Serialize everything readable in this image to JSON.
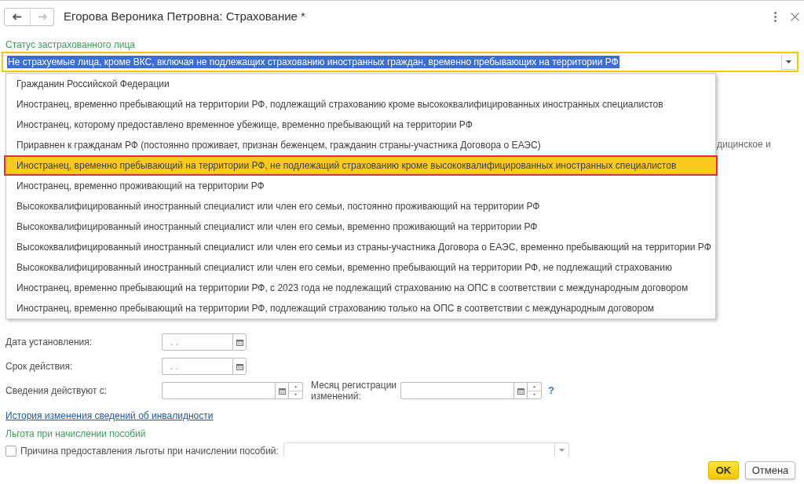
{
  "window": {
    "title": "Егорова Вероника Петровна: Страхование *"
  },
  "nav": [
    {
      "kind": "back",
      "disabled": false
    },
    {
      "kind": "forward",
      "disabled": true
    }
  ],
  "status_field": {
    "label": "Статус застрахованного лица",
    "value": "Не страхуемые лица, кроме ВКС, включая не подлежащих страхованию иностранных граждан, временно пребывающих на территории РФ",
    "focused": true,
    "text_selected": true,
    "expanded": true,
    "options": [
      {
        "label": "Гражданин Российской Федерации",
        "selected": false
      },
      {
        "label": "Иностранец, временно пребывающий на территории РФ, подлежащий страхованию кроме высококвалифицированных иностранных специалистов",
        "selected": false
      },
      {
        "label": "Иностранец, которому предоставлено временное убежище, временно пребывающий на территории РФ",
        "selected": false
      },
      {
        "label": "Приравнен к гражданам РФ (постоянно проживает, признан беженцем, гражданин страны-участника Договора о ЕАЭС)",
        "selected": false
      },
      {
        "label": "Иностранец, временно пребывающий на территории РФ, не подлежащий страхованию кроме высококвалифицированных иностранных специалистов",
        "selected": true
      },
      {
        "label": "Иностранец, временно проживающий на территории РФ",
        "selected": false
      },
      {
        "label": "Высококвалифицированный иностранный специалист или член его семьи, постоянно проживающий на территории РФ",
        "selected": false
      },
      {
        "label": "Высококвалифицированный иностранный специалист или член его семьи, временно проживающий на территории РФ",
        "selected": false
      },
      {
        "label": "Высококвалифицированный иностранный специалист или член его семьи из страны-участника Договора о ЕАЭС, временно пребывающий на территории РФ",
        "selected": false
      },
      {
        "label": "Высококвалифицированный иностранный специалист или член его семьи, временно пребывающий на территории РФ, не подлежащий страхованию",
        "selected": false
      },
      {
        "label": "Иностранец, временно пребывающий на территории РФ, с 2023 года не подлежащий страхованию на ОПС в соответствии с международным договором",
        "selected": false
      },
      {
        "label": "Иностранец, временно пребывающий на территории РФ, подлежащий страхованию только на ОПС в соответствии с международным договором",
        "selected": false
      }
    ]
  },
  "covered_form": {
    "partial_text": "дицинское и"
  },
  "field_rows": [
    [
      {
        "label": "Дата установления:",
        "kind": "date",
        "placeholder": ". ."
      }
    ],
    [
      {
        "label": "Срок действия:",
        "kind": "date",
        "placeholder": ". ."
      }
    ],
    [
      {
        "label": "Сведения действуют с:",
        "kind": "month"
      },
      {
        "label": "Месяц регистрации изменений:",
        "kind": "month",
        "help": "?"
      }
    ]
  ],
  "history_link": "История изменения сведений об инвалидности",
  "benefit": {
    "title": "Льгота при начислении пособий",
    "checkbox": {
      "label": "Причина предоставления льготы при начислении пособий:",
      "checked": false
    }
  },
  "buttons": [
    {
      "label": "OK",
      "kind": "primary"
    },
    {
      "label": "Отмена",
      "kind": "secondary"
    }
  ]
}
